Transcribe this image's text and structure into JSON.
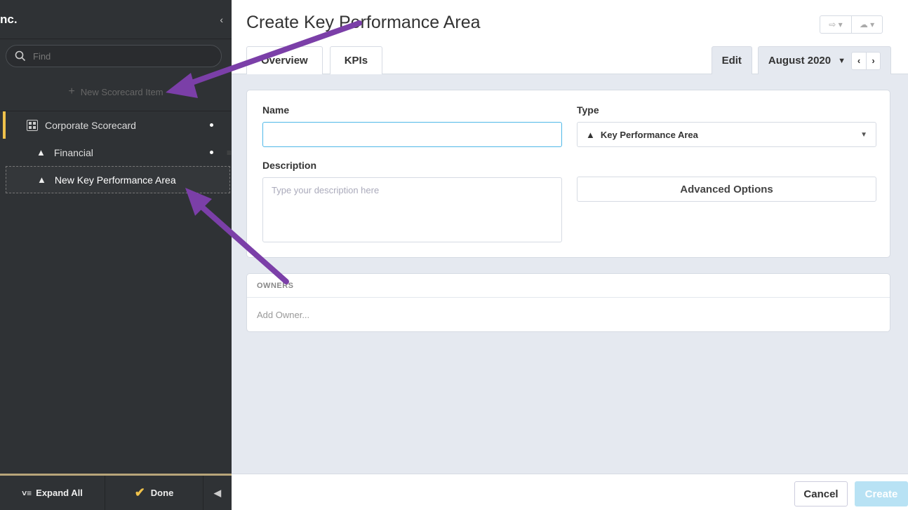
{
  "sidebar": {
    "title": "nc.",
    "collapse_glyph": "‹",
    "search_placeholder": "Find",
    "new_item_label": "New Scorecard Item",
    "tree": [
      {
        "label": "Corporate Scorecard",
        "type": "scorecard"
      },
      {
        "label": "Financial",
        "type": "kpa"
      },
      {
        "label": "New Key Performance Area",
        "type": "kpa",
        "selected": true
      }
    ],
    "footer": {
      "expand_label": "Expand All",
      "done_label": "Done"
    }
  },
  "header": {
    "title": "Create Key Performance Area",
    "tabs": [
      "Overview",
      "KPIs"
    ],
    "edit_label": "Edit",
    "period_label": "August 2020"
  },
  "form": {
    "name_label": "Name",
    "name_value": "",
    "type_label": "Type",
    "type_value": "Key Performance Area",
    "description_label": "Description",
    "description_placeholder": "Type your description here",
    "advanced_label": "Advanced Options"
  },
  "owners": {
    "heading": "OWNERS",
    "add_label": "Add Owner..."
  },
  "actions": {
    "cancel_label": "Cancel",
    "create_label": "Create"
  },
  "colors": {
    "sidebar_bg": "#2f3235",
    "accent_yellow": "#f0c24b",
    "focus_blue": "#4fb8e8",
    "annotation_arrow": "#7b3fa8"
  }
}
